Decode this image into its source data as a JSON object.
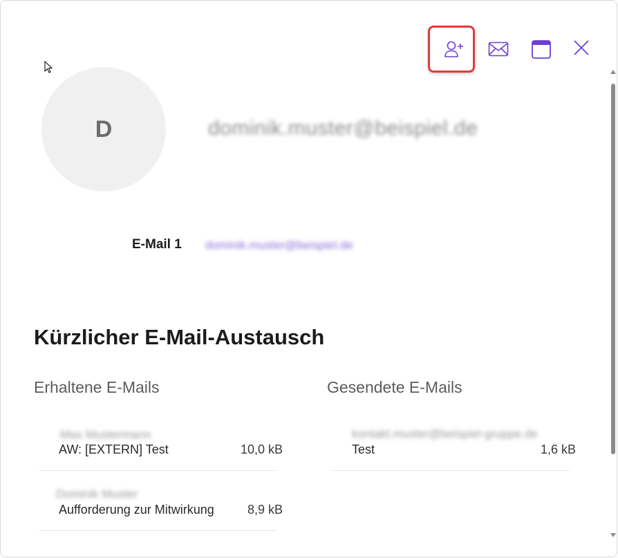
{
  "toolbar": {
    "add_contact_icon": "person-add-icon",
    "mail_icon": "mail-icon",
    "calendar_icon": "calendar-icon",
    "close_icon": "close-icon",
    "accent_color": "#6b3fd4",
    "highlight_color": "#e23b3b"
  },
  "contact": {
    "avatar_initial": "D",
    "display_name": "dominik.muster@beispiel.de",
    "email_label": "E-Mail 1",
    "email_value": "dominik.muster@beispiel.de"
  },
  "recent": {
    "title": "Kürzlicher E-Mail-Austausch",
    "received": {
      "title": "Erhaltene E-Mails",
      "items": [
        {
          "sender": "Max Mustermann",
          "subject": "AW: [EXTERN] Test",
          "size": "10,0 kB"
        },
        {
          "sender": "Dominik Muster",
          "subject": "Aufforderung zur Mitwirkung",
          "size": "8,9 kB"
        }
      ]
    },
    "sent": {
      "title": "Gesendete E-Mails",
      "items": [
        {
          "sender": "kontakt.muster@beispiel-gruppe.de",
          "subject": "Test",
          "size": "1,6 kB"
        }
      ]
    }
  }
}
